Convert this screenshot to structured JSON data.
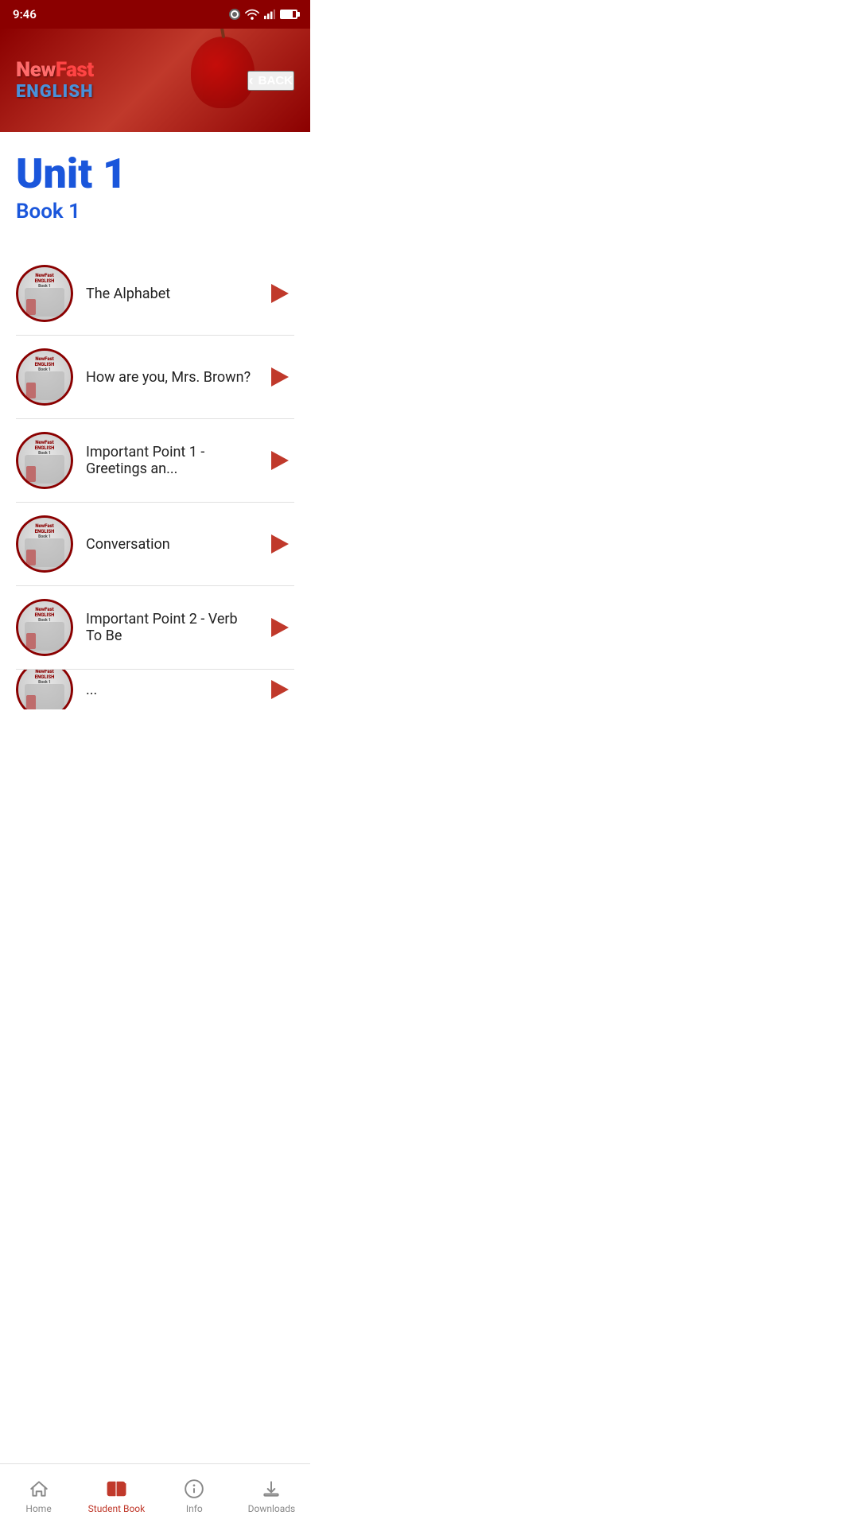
{
  "status": {
    "time": "9:46",
    "wifi": true,
    "signal": true,
    "battery": true
  },
  "header": {
    "logo_line1": "NewFast",
    "logo_line2": "ENGLISH",
    "back_label": "BACK"
  },
  "unit": {
    "title": "Unit 1",
    "subtitle": "Book 1"
  },
  "lessons": [
    {
      "id": 1,
      "name": "The Alphabet"
    },
    {
      "id": 2,
      "name": "How are you, Mrs. Brown?"
    },
    {
      "id": 3,
      "name": "Important Point 1 - Greetings an..."
    },
    {
      "id": 4,
      "name": "Conversation"
    },
    {
      "id": 5,
      "name": "Important Point 2 - Verb To Be"
    },
    {
      "id": 6,
      "name": "..."
    }
  ],
  "bottom_nav": {
    "items": [
      {
        "id": "home",
        "label": "Home",
        "active": false
      },
      {
        "id": "student-book",
        "label": "Student Book",
        "active": true
      },
      {
        "id": "info",
        "label": "Info",
        "active": false
      },
      {
        "id": "downloads",
        "label": "Downloads",
        "active": false
      }
    ]
  }
}
